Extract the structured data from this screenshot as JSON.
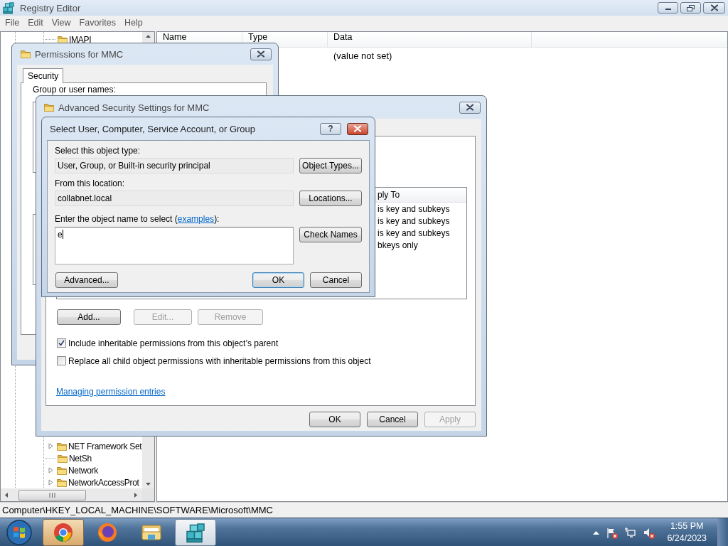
{
  "registry_editor": {
    "title": "Registry Editor",
    "active": false,
    "menu": [
      "File",
      "Edit",
      "View",
      "Favorites",
      "Help"
    ],
    "tree": [
      {
        "label": "IMAPI",
        "expandable": false
      },
      {
        "label": "NET Framework Set",
        "expandable": true
      },
      {
        "label": "NetSh",
        "expandable": false
      },
      {
        "label": "Network",
        "expandable": true
      },
      {
        "label": "NetworkAccessProt",
        "expandable": true
      }
    ],
    "columns": [
      "Name",
      "Type",
      "Data"
    ],
    "rows": [
      {
        "data": "(value not set)"
      }
    ],
    "status_bar": "Computer\\HKEY_LOCAL_MACHINE\\SOFTWARE\\Microsoft\\MMC"
  },
  "permissions_dialog": {
    "title": "Permissions for MMC",
    "active": false,
    "tabs": [
      {
        "label": "Security",
        "selected": true
      }
    ],
    "group_label": "Group or user names:"
  },
  "advanced_dialog": {
    "title": "Advanced Security Settings for MMC",
    "active": false,
    "list_header_fragment": "ply To",
    "list_fragments": [
      "is key and subkeys",
      "is key and subkeys",
      "is key and subkeys",
      "bkeys only"
    ],
    "buttons": [
      {
        "label": "Add...",
        "disabled": false
      },
      {
        "label": "Edit...",
        "disabled": true
      },
      {
        "label": "Remove",
        "disabled": true
      }
    ],
    "checkboxes": [
      {
        "label": "Include inheritable permissions from this object’s parent",
        "checked": true
      },
      {
        "label": "Replace all child object permissions with inheritable permissions from this object",
        "checked": false
      }
    ],
    "link": "Managing permission entries",
    "footer_buttons": [
      {
        "label": "OK",
        "disabled": false
      },
      {
        "label": "Cancel",
        "disabled": false
      },
      {
        "label": "Apply",
        "disabled": true
      }
    ]
  },
  "select_dialog": {
    "title": "Select User, Computer, Service Account, or Group",
    "active": true,
    "help": "?",
    "fields": [
      {
        "kind": "readonly",
        "label": "Select this object type:",
        "value": "User, Group, or Built-in security principal",
        "button": "Object Types..."
      },
      {
        "kind": "readonly",
        "label": "From this location:",
        "value": "collabnet.local",
        "button": "Locations..."
      },
      {
        "kind": "editable",
        "label": "Enter the object name to select (",
        "link": "examples",
        "label_after": "):",
        "value": "e",
        "button": "Check Names"
      }
    ],
    "buttons": [
      {
        "label": "Advanced...",
        "default": false
      },
      {
        "label": "OK",
        "default": true
      },
      {
        "label": "Cancel",
        "default": false
      }
    ]
  },
  "taskbar": {
    "apps": [
      {
        "kind": "chrome",
        "highlighted": true,
        "selected": false
      },
      {
        "kind": "firefox",
        "highlighted": false,
        "selected": false
      },
      {
        "kind": "explorer",
        "highlighted": false,
        "selected": false
      },
      {
        "kind": "regedit",
        "highlighted": false,
        "selected": true
      }
    ],
    "time": "1:55 PM",
    "date": "6/24/2023"
  }
}
